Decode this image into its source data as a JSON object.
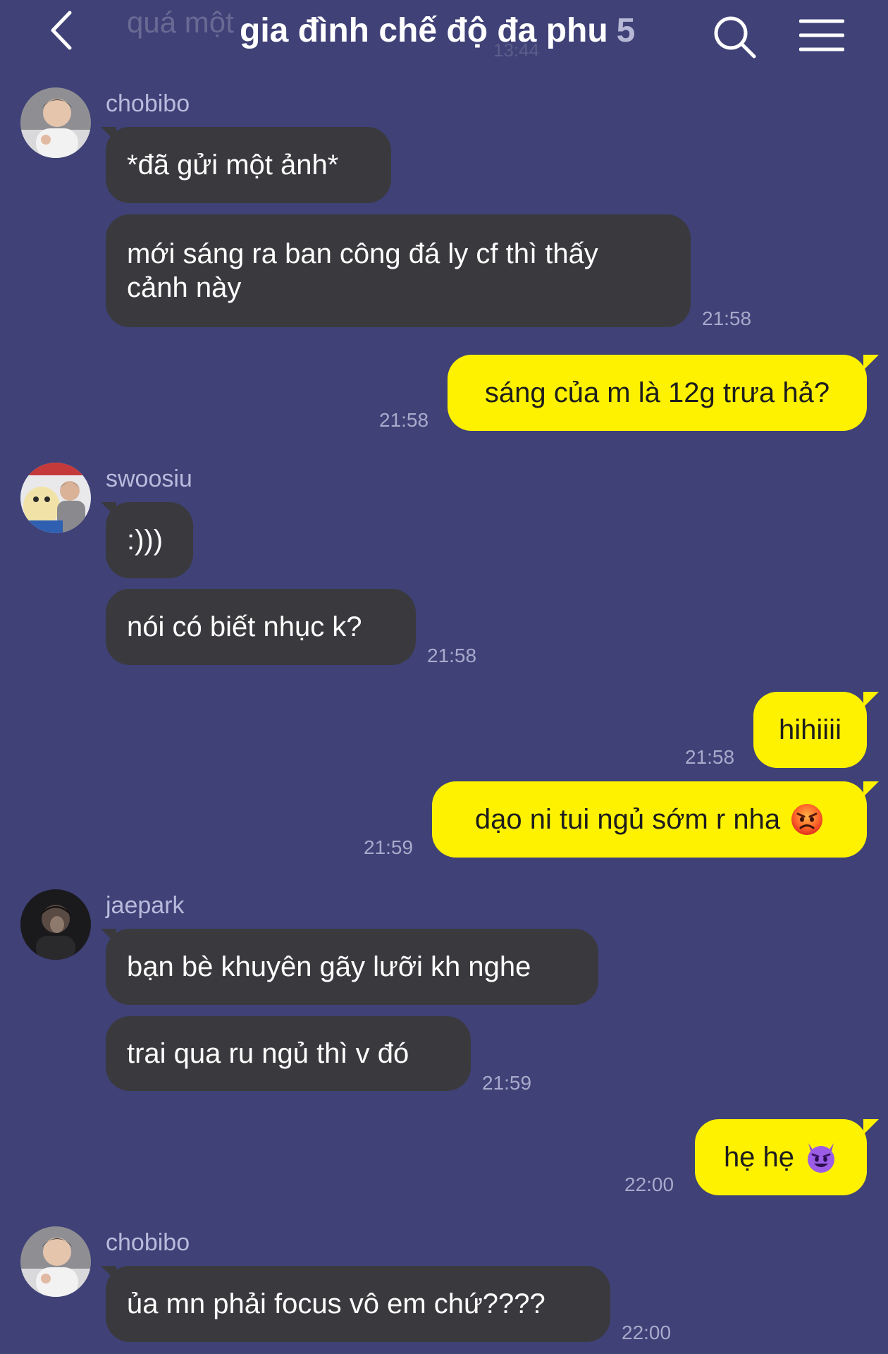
{
  "header": {
    "title": "gia đình chế độ đa phu",
    "member_count": "5",
    "background_preview": "quá một",
    "background_time": "13:44"
  },
  "colors": {
    "background": "#3f4177",
    "incoming_bubble": "#3a3a3e",
    "outgoing_bubble": "#fef200"
  },
  "messages": [
    {
      "sender": "chobibo",
      "text": "*đã gửi một ảnh*"
    },
    {
      "text_line1": "mới sáng ra ban công đá ly cf thì thấy",
      "text_line2": "cảnh này",
      "time": "21:58"
    },
    {
      "text": "sáng của m là 12g trưa hả?",
      "time": "21:58"
    },
    {
      "sender": "swoosiu",
      "text": ":)))"
    },
    {
      "text": "nói có biết nhục k?",
      "time": "21:58"
    },
    {
      "text": "hihiiii",
      "time": "21:58"
    },
    {
      "text": "dạo ni tui ngủ sớm r nha",
      "time": "21:59",
      "emoji": "angry-face"
    },
    {
      "sender": "jaepark",
      "text": "bạn bè khuyên gãy lưỡi kh nghe"
    },
    {
      "text": "trai qua ru ngủ thì v đó",
      "time": "21:59"
    },
    {
      "text": "hẹ hẹ",
      "time": "22:00",
      "emoji": "smiling-devil"
    },
    {
      "sender": "chobibo",
      "text": "ủa mn phải focus vô em chứ????",
      "time": "22:00"
    }
  ]
}
